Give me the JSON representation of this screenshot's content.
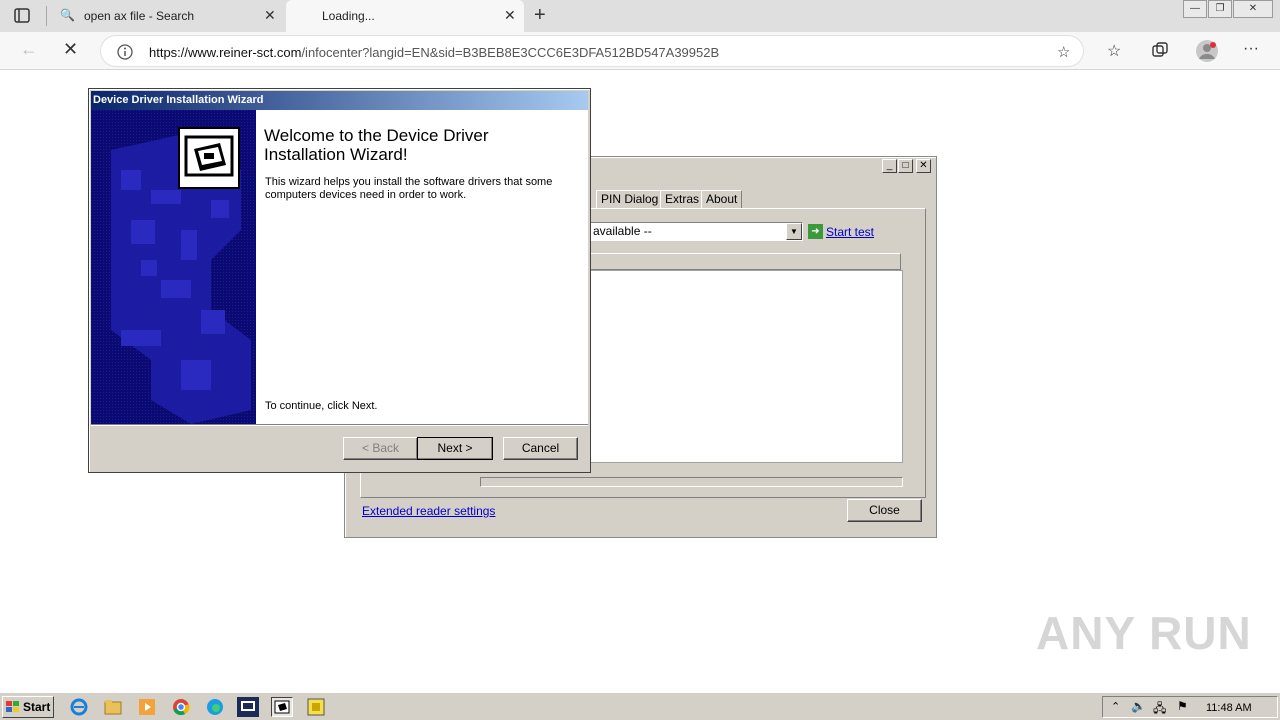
{
  "browser": {
    "tabs": [
      {
        "label": "open ax file - Search",
        "active": false
      },
      {
        "label": "Loading...",
        "active": true
      }
    ],
    "url_host": "https://www.reiner-sct.com",
    "url_path": "/infocenter?langid=EN&sid=B3BEB8E3CCC6E3DFA512BD547A39952B"
  },
  "wizard": {
    "title": "Device Driver Installation Wizard",
    "heading": "Welcome to the Device Driver Installation Wizard!",
    "description": "This wizard helps you install the software drivers that some computers devices need in order to work.",
    "continue_text": "To continue, click Next.",
    "back_label": "< Back",
    "next_label": "Next >",
    "cancel_label": "Cancel"
  },
  "reader_window": {
    "tabs": [
      "PIN Dialog",
      "Extras",
      "About"
    ],
    "combo_value": "available --",
    "start_test_label": "Start test",
    "extended_link": "Extended reader settings",
    "close_label": "Close"
  },
  "taskbar": {
    "start_label": "Start",
    "clock": "11:48 AM"
  },
  "watermark": "ANY RUN"
}
